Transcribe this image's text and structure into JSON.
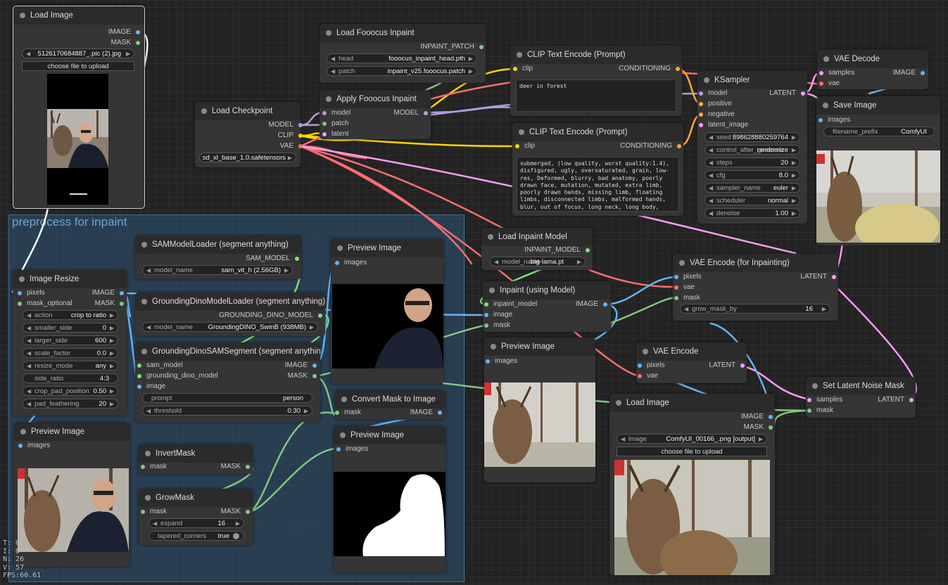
{
  "colors": {
    "model": "#b39ddb",
    "clip": "#ffd500",
    "vae": "#ff6e6e",
    "conditioning": "#ffa931",
    "latent": "#ff9cf9",
    "image": "#64b5f6",
    "mask": "#81c784",
    "sam": "#7de07d",
    "inpaint_model": "#7de07d",
    "patch": "#81c784",
    "wire_white": "#ffffff"
  },
  "group": {
    "title": "preprocess for inpaint"
  },
  "stats": {
    "t": "T: 0.",
    "i": "I: 0",
    "n": "N: 26",
    "v": "V: 57",
    "fps": "FPS:60.61"
  },
  "nodes": {
    "load_image_top": {
      "title": "Load Image",
      "out_image": "IMAGE",
      "out_mask": "MASK",
      "image_value": "5126170684887_.pic (2).jpg",
      "upload": "choose file to upload"
    },
    "load_checkpoint": {
      "title": "Load Checkpoint",
      "out_model": "MODEL",
      "out_clip": "CLIP",
      "out_vae": "VAE",
      "ckpt_value": "sd_xl_base_1.0.safetensors"
    },
    "load_fooocus": {
      "title": "Load Fooocus Inpaint",
      "out_patch": "INPAINT_PATCH",
      "head_label": "head",
      "head_value": "fooocus_inpaint_head.pth",
      "patch_label": "patch",
      "patch_value": "inpaint_v25.fooocus.patch"
    },
    "apply_fooocus": {
      "title": "Apply Fooocus Inpaint",
      "in_model": "model",
      "in_patch": "patch",
      "in_latent": "latent",
      "out_model": "MODEL"
    },
    "clip_pos": {
      "title": "CLIP Text Encode (Prompt)",
      "in_clip": "clip",
      "out": "CONDITIONING",
      "text": "deer in forest"
    },
    "clip_neg": {
      "title": "CLIP Text Encode (Prompt)",
      "in_clip": "clip",
      "out": "CONDITIONING",
      "text": "submerged, (low quality, worst quality:1.4), disfigured, ugly, oversaturated, grain, low-res, Deformed, blurry, bad anatomy, poorly drawn face, mutation, mutated, extra limb, poorly drawn hands, missing limb, floating limbs, disconnected limbs, malformed hands, blur, out of focus, long neck, long body, disgusting, poorly drawn, mutilated, mangled, surreal, text"
    },
    "ksampler": {
      "title": "KSampler",
      "in_model": "model",
      "in_positive": "positive",
      "in_negative": "negative",
      "in_latent": "latent_image",
      "out": "LATENT",
      "widgets": [
        {
          "label": "seed",
          "value": "898628880259764"
        },
        {
          "label": "control_after_generate",
          "value": "randomize"
        },
        {
          "label": "steps",
          "value": "20"
        },
        {
          "label": "cfg",
          "value": "8.0"
        },
        {
          "label": "sampler_name",
          "value": "euler"
        },
        {
          "label": "scheduler",
          "value": "normal"
        },
        {
          "label": "denoise",
          "value": "1.00"
        }
      ]
    },
    "vae_decode": {
      "title": "VAE Decode",
      "in_samples": "samples",
      "in_vae": "vae",
      "out": "IMAGE"
    },
    "save_image": {
      "title": "Save Image",
      "in_images": "images",
      "prefix_label": "filename_prefix",
      "prefix_value": "ComfyUI"
    },
    "image_resize": {
      "title": "Image Resize",
      "in_pixels": "pixels",
      "in_mask": "mask_optional",
      "out_image": "IMAGE",
      "out_mask": "MASK",
      "widgets": [
        {
          "label": "action",
          "value": "crop to ratio"
        },
        {
          "label": "smaller_side",
          "value": "0"
        },
        {
          "label": "larger_side",
          "value": "600"
        },
        {
          "label": "scale_factor",
          "value": "0.0"
        },
        {
          "label": "resize_mode",
          "value": "any"
        },
        {
          "label": "side_ratio",
          "value": "4:3"
        },
        {
          "label": "crop_pad_position",
          "value": "0.50"
        },
        {
          "label": "pad_feathering",
          "value": "20"
        }
      ]
    },
    "sam_loader": {
      "title": "SAMModelLoader (segment anything)",
      "out": "SAM_MODEL",
      "label": "model_name",
      "value": "sam_vit_h (2.56GB)"
    },
    "gd_loader": {
      "title": "GroundingDinoModelLoader (segment anything)",
      "out": "GROUNDING_DINO_MODEL",
      "label": "model_name",
      "value": "GroundingDINO_SwinB (938MB)"
    },
    "gd_sam": {
      "title": "GroundingDinoSAMSegment (segment anything)",
      "in_sam": "sam_model",
      "in_gd": "grounding_dino_model",
      "in_image": "image",
      "out_image": "IMAGE",
      "out_mask": "MASK",
      "prompt_label": "prompt",
      "prompt_value": "person",
      "threshold_label": "threshold",
      "threshold_value": "0.30"
    },
    "preview_1": {
      "title": "Preview Image",
      "in_images": "images"
    },
    "preview_left": {
      "title": "Preview Image",
      "in_images": "images"
    },
    "convert_mask": {
      "title": "Convert Mask to Image",
      "in_mask": "mask",
      "out": "IMAGE"
    },
    "preview_mask": {
      "title": "Preview Image",
      "in_images": "images"
    },
    "invert_mask": {
      "title": "InvertMask",
      "in_mask": "mask",
      "out": "MASK"
    },
    "grow_mask": {
      "title": "GrowMask",
      "in_mask": "mask",
      "out": "MASK",
      "expand_label": "expand",
      "expand_value": "16",
      "tapered_label": "tapered_corners",
      "tapered_value": "true"
    },
    "load_inpaint_model": {
      "title": "Load Inpaint Model",
      "out": "INPAINT_MODEL",
      "label": "model_name",
      "value": "big-lama.pt"
    },
    "inpaint_using": {
      "title": "Inpaint (using Model)",
      "in_model": "inpaint_model",
      "in_image": "image",
      "in_mask": "mask",
      "out": "IMAGE"
    },
    "preview_mid": {
      "title": "Preview Image",
      "in_images": "images"
    },
    "vae_encode_inpaint": {
      "title": "VAE Encode (for Inpainting)",
      "in_pixels": "pixels",
      "in_vae": "vae",
      "in_mask": "mask",
      "out": "LATENT",
      "grow_label": "grow_mask_by",
      "grow_value": "16"
    },
    "vae_encode": {
      "title": "VAE Encode",
      "in_pixels": "pixels",
      "in_vae": "vae",
      "out": "LATENT"
    },
    "set_latent_mask": {
      "title": "Set Latent Noise Mask",
      "in_samples": "samples",
      "in_mask": "mask",
      "out": "LATENT"
    },
    "load_image_bottom": {
      "title": "Load Image",
      "out_image": "IMAGE",
      "out_mask": "MASK",
      "image_label": "image",
      "image_value": "ComfyUI_00166_.png [output]",
      "upload": "choose file to upload"
    }
  }
}
